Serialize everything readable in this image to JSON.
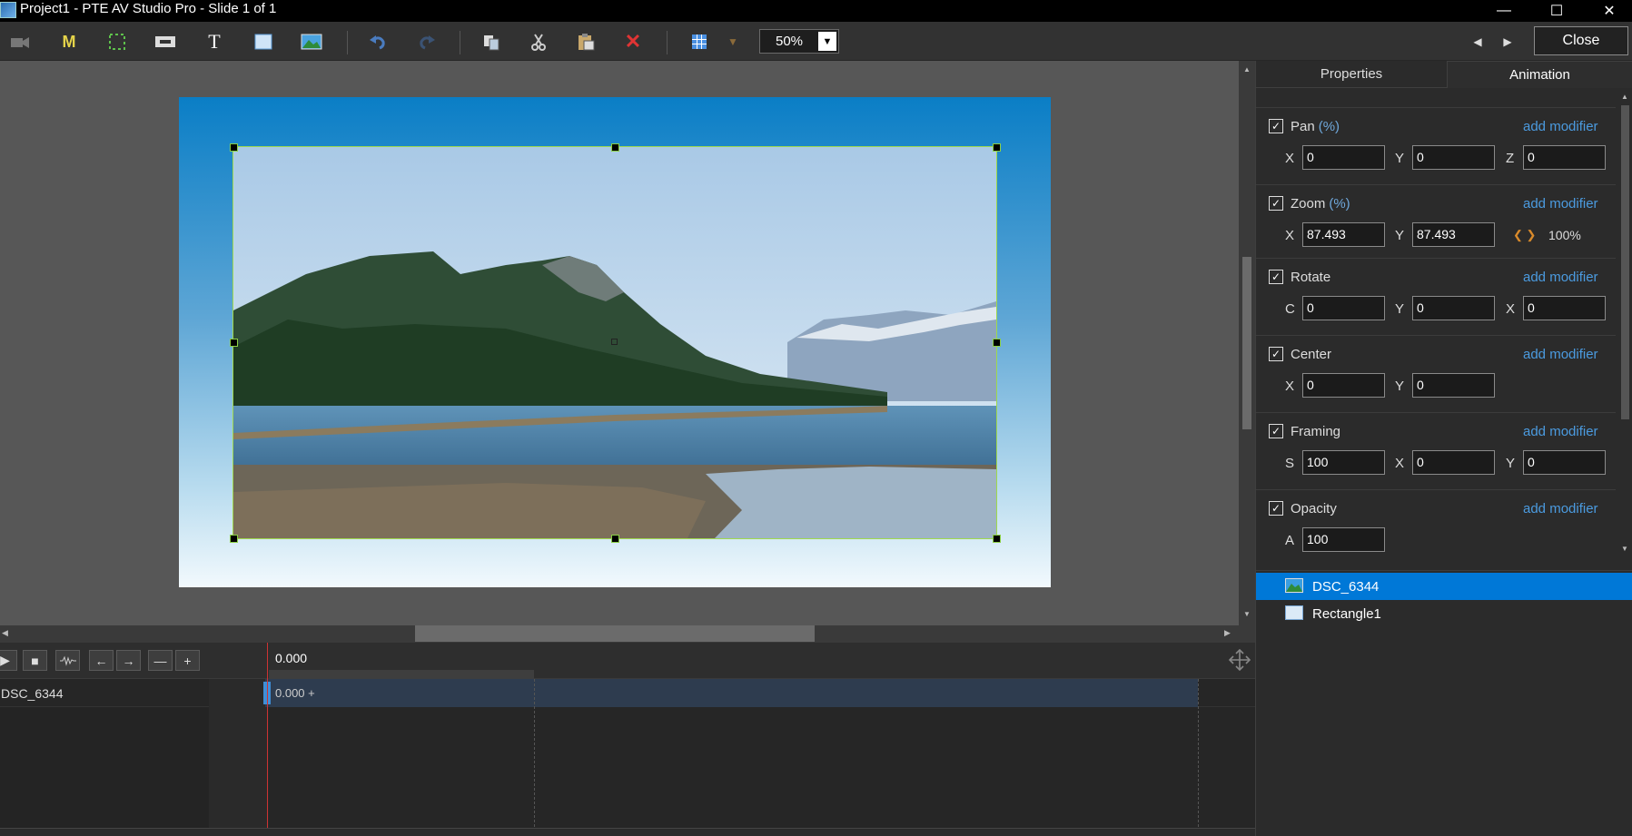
{
  "window": {
    "title": "Project1 - PTE AV Studio Pro - Slide 1 of 1"
  },
  "toolbar": {
    "zoom_value": "50%",
    "close_label": "Close"
  },
  "timeline": {
    "time": "0.000",
    "row_name": "DSC_6344",
    "key_label": "0.000 +"
  },
  "panel": {
    "tabs": [
      "Properties",
      "Animation"
    ],
    "sections": {
      "pan": {
        "name": "Pan",
        "unit": "(%)",
        "modifier": "add modifier",
        "labels": [
          "X",
          "Y",
          "Z"
        ],
        "values": [
          "0",
          "0",
          "0"
        ]
      },
      "zoom": {
        "name": "Zoom",
        "unit": "(%)",
        "modifier": "add modifier",
        "labels": [
          "X",
          "Y"
        ],
        "values": [
          "87.493",
          "87.493"
        ],
        "reset": "100%"
      },
      "rotate": {
        "name": "Rotate",
        "modifier": "add modifier",
        "labels": [
          "C",
          "Y",
          "X"
        ],
        "values": [
          "0",
          "0",
          "0"
        ]
      },
      "center": {
        "name": "Center",
        "modifier": "add modifier",
        "labels": [
          "X",
          "Y"
        ],
        "values": [
          "0",
          "0"
        ]
      },
      "framing": {
        "name": "Framing",
        "modifier": "add modifier",
        "labels": [
          "S",
          "X",
          "Y"
        ],
        "values": [
          "100",
          "0",
          "0"
        ]
      },
      "opacity": {
        "name": "Opacity",
        "modifier": "add modifier",
        "labels": [
          "A"
        ],
        "values": [
          "100"
        ]
      }
    },
    "objects": [
      {
        "name": "DSC_6344",
        "selected": true
      },
      {
        "name": "Rectangle1",
        "selected": false
      }
    ]
  },
  "colors": {
    "accent": "#0078d7",
    "link": "#4b9be0",
    "selection_outline": "#9fd84e"
  }
}
